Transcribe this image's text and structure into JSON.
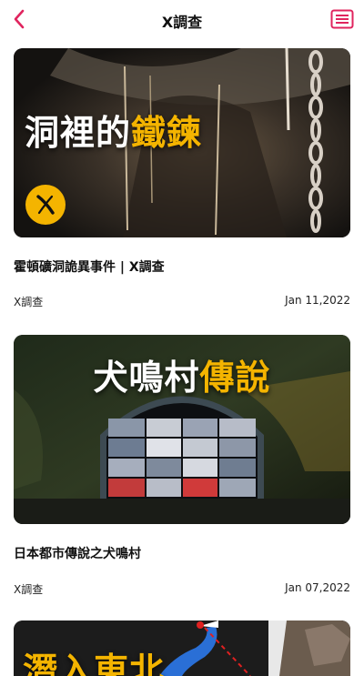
{
  "header": {
    "title": "X調查",
    "accent_color": "#e0245e"
  },
  "articles": [
    {
      "thumb_text_white": "洞裡的",
      "thumb_text_yellow": "鐵鍊",
      "title": "霍頓礦洞詭異事件 | X調查",
      "source": "X調查",
      "date": "Jan 11,2022"
    },
    {
      "thumb_text_white": "犬鳴村",
      "thumb_text_yellow": "傳說",
      "title": "日本都市傳說之犬鳴村",
      "source": "X調查",
      "date": "Jan 07,2022"
    },
    {
      "thumb_text_white": "潛入東北"
    }
  ]
}
